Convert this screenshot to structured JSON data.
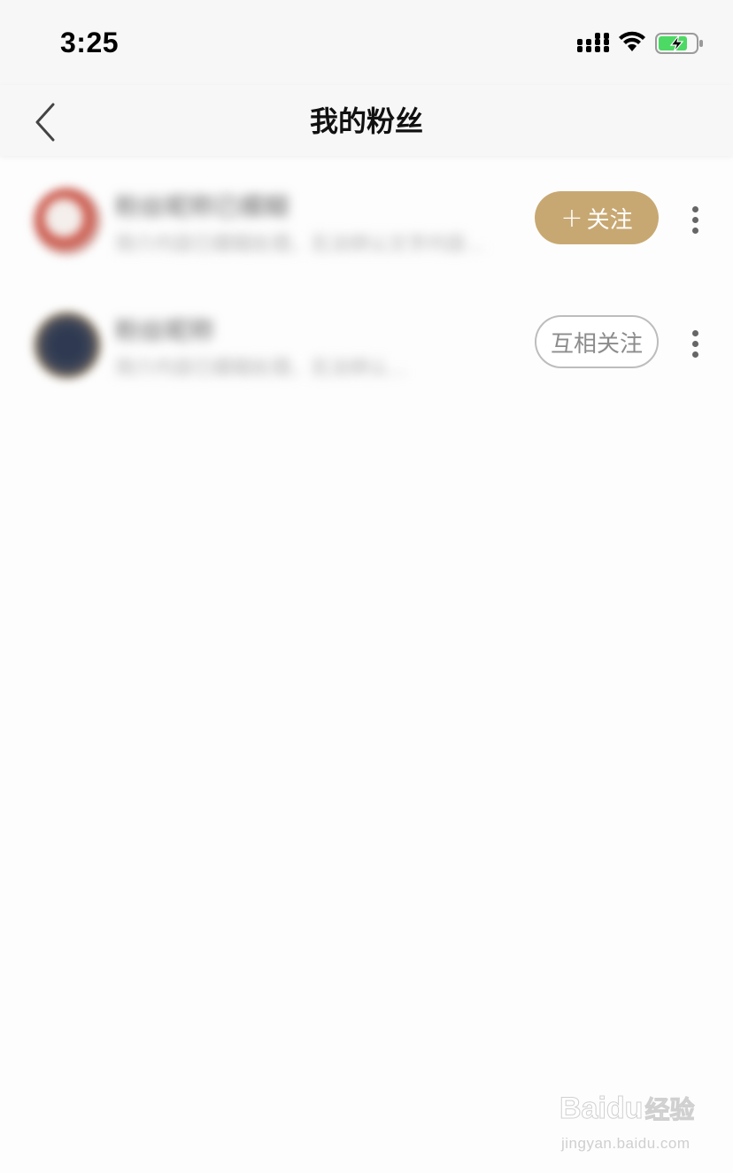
{
  "status_bar": {
    "time": "3:25",
    "icons": [
      "signal-icon",
      "wifi-icon",
      "battery-charging-icon"
    ],
    "battery_color": "#4cd964"
  },
  "nav": {
    "title": "我的粉丝",
    "back_icon": "chevron-left-icon"
  },
  "fans": [
    {
      "name": "粉丝昵称已模糊",
      "bio": "简介内容已模糊处理，无法辨认文字内容…",
      "button": {
        "label": "关注",
        "prefix": "+",
        "style": "primary"
      }
    },
    {
      "name": "粉丝昵称",
      "bio": "简介内容已模糊处理，无法辨认…",
      "button": {
        "label": "互相关注",
        "prefix": "",
        "style": "outline"
      }
    }
  ],
  "colors": {
    "accent": "#c8a872",
    "outline": "#bdbdbd",
    "background": "#fdfdfd"
  },
  "watermark": {
    "logo_text": "Baidu",
    "logo_cn": "经验",
    "url": "jingyan.baidu.com"
  }
}
